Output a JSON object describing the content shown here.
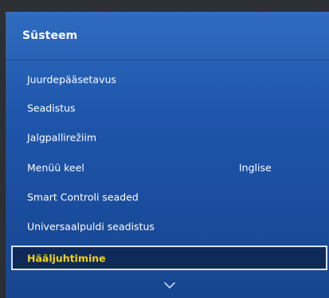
{
  "menu": {
    "title": "Süsteem",
    "items": [
      {
        "label": "Juurdepääsetavus",
        "value": ""
      },
      {
        "label": "Seadistus",
        "value": ""
      },
      {
        "label": "Jalgpallirežiim",
        "value": ""
      },
      {
        "label": "Menüü keel",
        "value": "Inglise"
      },
      {
        "label": "Smart Controli seaded",
        "value": ""
      },
      {
        "label": "Universaalpuldi seadistus",
        "value": ""
      },
      {
        "label": "Hääljuhtimine",
        "value": ""
      }
    ],
    "selected_index": 6,
    "scroll_icon": "chevron-down-icon"
  },
  "colors": {
    "panel_blue": "#1e56ab",
    "selected_bg": "#0d2a59",
    "selected_text": "#f4d21c",
    "text": "#ffffff"
  }
}
